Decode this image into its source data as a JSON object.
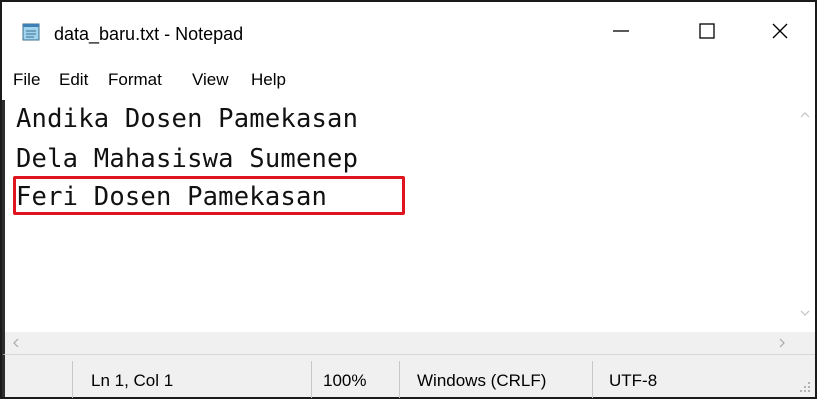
{
  "window": {
    "title": "data_baru.txt - Notepad",
    "icon": "notepad-icon"
  },
  "titlebar_buttons": {
    "minimize_icon": "minimize-icon",
    "maximize_icon": "maximize-icon",
    "close_icon": "close-icon"
  },
  "menu": {
    "items": [
      {
        "label": "File"
      },
      {
        "label": "Edit"
      },
      {
        "label": "Format"
      },
      {
        "label": "View"
      },
      {
        "label": "Help"
      }
    ]
  },
  "editor": {
    "lines": [
      "Andika Dosen Pamekasan",
      "Dela Mahasiswa Sumenep",
      "Feri Dosen Pamekasan"
    ],
    "highlight_color": "#e0141e"
  },
  "status": {
    "position": "Ln 1, Col 1",
    "zoom": "100%",
    "line_ending": "Windows (CRLF)",
    "encoding": "UTF-8"
  },
  "colors": {
    "statusbar_bg": "#f0f0f0",
    "border": "#1a1a1a"
  }
}
